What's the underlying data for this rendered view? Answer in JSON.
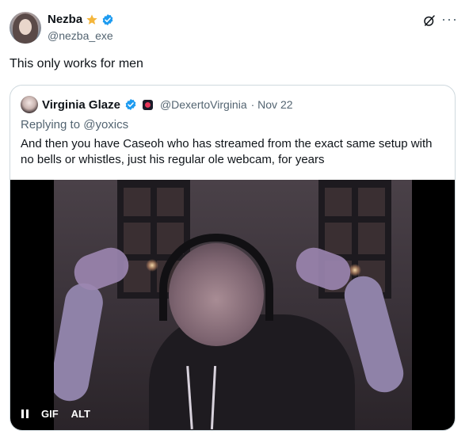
{
  "tweet": {
    "author_name": "Nezba",
    "author_handle": "@nezba_exe",
    "text": "This only works for men",
    "more_label": "···"
  },
  "quote": {
    "author_name": "Virginia Glaze",
    "author_handle": "@DexertoVirginia",
    "date": "· Nov 22",
    "replying_to": "Replying to @yoxics",
    "text": "And then you have Caseoh who has streamed from the exact same setup with no bells or whistles, just his regular ole webcam, for years"
  },
  "media": {
    "pause_label": "",
    "gif_label": "GIF",
    "alt_label": "ALT"
  },
  "colors": {
    "verified": "#1d9bf0",
    "star": "#f4b63c",
    "secondary_text": "#536471"
  }
}
